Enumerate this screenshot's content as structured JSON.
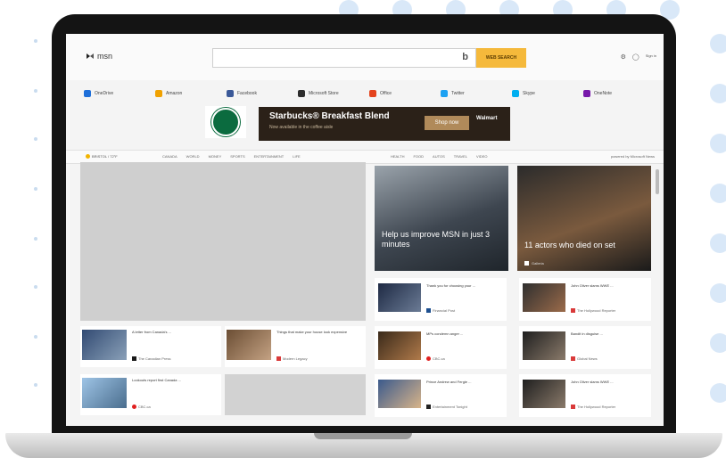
{
  "header": {
    "logo_text": "msn",
    "search_placeholder": "",
    "search_button": "WEB SEARCH",
    "bing_glyph": "b",
    "account_label": "Sign in"
  },
  "quick_links": [
    {
      "label": "OneDrive",
      "icon": "onedrive-icon",
      "color": "#1e6fd9"
    },
    {
      "label": "Amazon",
      "icon": "amazon-icon",
      "color": "#f0a100"
    },
    {
      "label": "Facebook",
      "icon": "facebook-icon",
      "color": "#3b5998"
    },
    {
      "label": "Microsoft Store",
      "icon": "store-icon",
      "color": "#2d2d2d"
    },
    {
      "label": "Office",
      "icon": "office-icon",
      "color": "#e4431d"
    },
    {
      "label": "Twitter",
      "icon": "twitter-icon",
      "color": "#1da1f2"
    },
    {
      "label": "Skype",
      "icon": "skype-icon",
      "color": "#00aff0"
    },
    {
      "label": "OneNote",
      "icon": "onenote-icon",
      "color": "#7719aa"
    }
  ],
  "ad": {
    "title": "Starbucks® Breakfast Blend",
    "subtitle": "Now available in the coffee aisle",
    "cta": "Shop now",
    "retailer": "Walmart"
  },
  "nav": {
    "weather": "BRISTOL / 72°F",
    "items": [
      "CANADA",
      "WORLD",
      "MONEY",
      "SPORTS",
      "ENTERTAINMENT",
      "LIFE"
    ],
    "right_items": [
      "HEALTH",
      "FOOD",
      "AUTOS",
      "TRAVEL",
      "VIDEO"
    ],
    "powered": "powered by Microsoft News"
  },
  "featured": [
    {
      "title": "Help us improve MSN in just 3 minutes",
      "source": ""
    },
    {
      "title": "11 actors who died on set",
      "source": "Galleria"
    }
  ],
  "left_cards": [
    {
      "title": "A letter from Canada's ...",
      "source": "The Canadian Press"
    },
    {
      "title": "Things that make your house look expensive",
      "source": "Modern Legacy"
    },
    {
      "title": "Lookouts report first Canada ...",
      "source": "CBC.ca"
    }
  ],
  "right_cards": [
    {
      "title": "Thank you for choosing your ...",
      "source": "Financial Post"
    },
    {
      "title": "John Oliver slams WWE ...",
      "source": "The Hollywood Reporter"
    },
    {
      "title": "MPs condemn anger ...",
      "source": "CBC.ca"
    },
    {
      "title": "Bandit in disguise ...",
      "source": "Global News"
    },
    {
      "title": "Prince Andrew and Fergie ...",
      "source": "Entertainment Tonight"
    },
    {
      "title": "John Oliver slams WWE ...",
      "source": "The Hollywood Reporter"
    }
  ],
  "colors": {
    "accent_search": "#f5b93b",
    "ad_bg": "#2b2118",
    "starbucks_green": "#0b6b3f"
  }
}
